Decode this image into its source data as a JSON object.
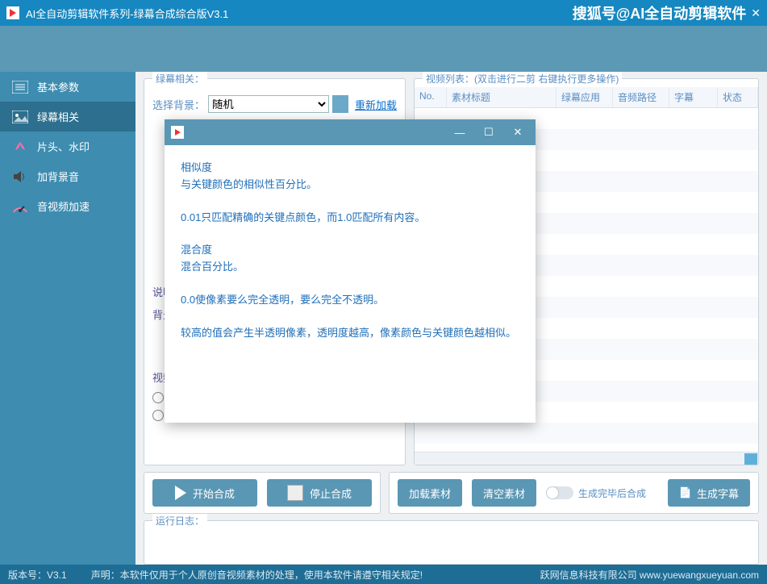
{
  "titlebar": {
    "title": "AI全自动剪辑软件系列-绿幕合成综合版V3.1",
    "watermark": "搜狐号@AI全自动剪辑软件"
  },
  "sidebar": {
    "items": [
      {
        "label": "基本参数"
      },
      {
        "label": "绿幕相关"
      },
      {
        "label": "片头、水印"
      },
      {
        "label": "加背景音"
      },
      {
        "label": "音视频加速"
      }
    ]
  },
  "leftpanel": {
    "legend": "绿幕相关：",
    "bg_label": "选择背景：",
    "bg_value": "随机",
    "reload": "重新加载",
    "note1": "说明",
    "note2": "背景",
    "note3": "视频"
  },
  "rightpanel": {
    "legend": "视频列表：(双击进行二剪 右键执行更多操作)",
    "cols": {
      "c1": "No.",
      "c2": "素材标题",
      "c3": "绿幕应用",
      "c4": "音频路径",
      "c5": "字幕",
      "c6": "状态"
    }
  },
  "buttons": {
    "start": "开始合成",
    "stop": "停止合成",
    "load": "加载素材",
    "clear": "清空素材",
    "toggle": "生成完毕后合成",
    "subs": "生成字幕"
  },
  "log": {
    "legend": "运行日志："
  },
  "footer": {
    "ver": "版本号：V3.1",
    "disc": "声明：本软件仅用于个人原创音视频素材的处理，使用本软件请遵守相关规定!",
    "brand": "跃网信息科技有限公司  www.yuewangxueyuan.com"
  },
  "modal": {
    "p1": "相似度",
    "p2": "与关键颜色的相似性百分比。",
    "p3": "0.01只匹配精确的关键点颜色，而1.0匹配所有内容。",
    "p4": "混合度",
    "p5": "混合百分比。",
    "p6": "0.0使像素要么完全透明，要么完全不透明。",
    "p7": "较高的值会产生半透明像素，透明度越高，像素颜色与关键颜色越相似。"
  }
}
